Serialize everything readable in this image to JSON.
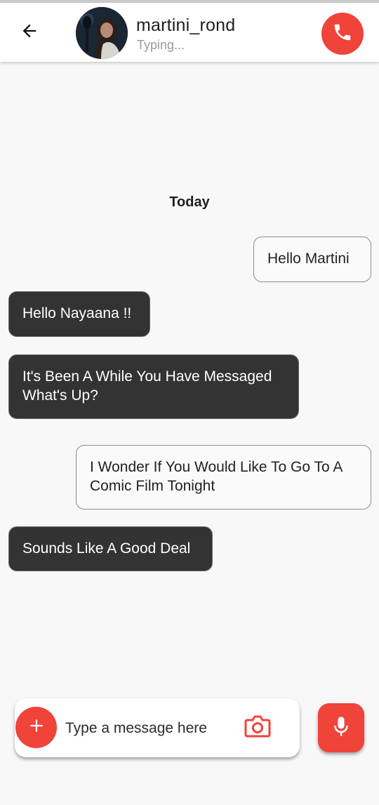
{
  "header": {
    "contact_name": "martini_rond",
    "status": "Typing...",
    "back_icon": "arrow-left-icon",
    "call_icon": "phone-icon"
  },
  "chat": {
    "date_separator": "Today",
    "messages": [
      {
        "direction": "outgoing",
        "text": "Hello Martini"
      },
      {
        "direction": "incoming",
        "text": "Hello Nayaana !!"
      },
      {
        "direction": "incoming",
        "text": "It's Been A While You Have Messaged What's Up?"
      },
      {
        "direction": "outgoing",
        "text": "I Wonder If You Would Like To Go To A Comic Film Tonight"
      },
      {
        "direction": "incoming",
        "text": "Sounds Like A Good Deal"
      }
    ]
  },
  "composer": {
    "placeholder": "Type a message here",
    "value": "",
    "add_icon": "plus-icon",
    "camera_icon": "camera-icon",
    "mic_icon": "microphone-icon"
  },
  "colors": {
    "accent": "#f0433a",
    "incoming_bubble": "#333333",
    "outgoing_bubble": "#fafafa",
    "background": "#f8f8f8"
  }
}
